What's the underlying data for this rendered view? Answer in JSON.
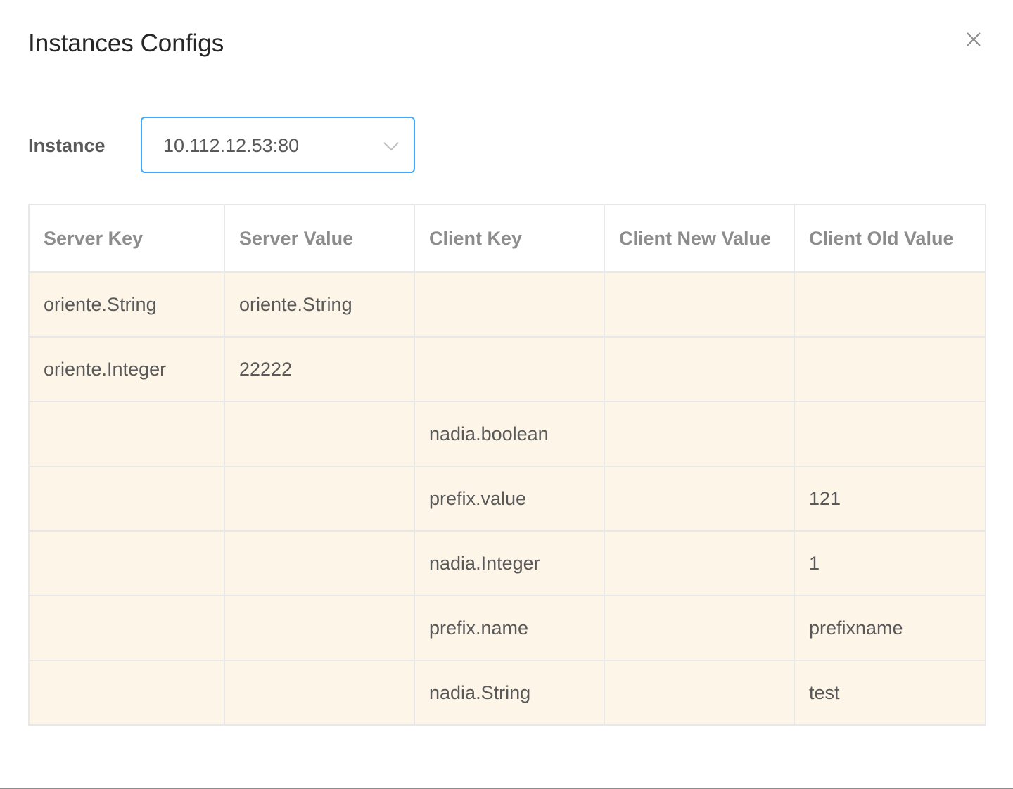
{
  "dialog": {
    "title": "Instances Configs",
    "close_icon": "close-icon"
  },
  "instance_field": {
    "label": "Instance",
    "selected_value": "10.112.12.53:80",
    "arrow_icon": "chevron-down-icon"
  },
  "table": {
    "columns": [
      "Server Key",
      "Server Value",
      "Client Key",
      "Client New Value",
      "Client Old Value"
    ],
    "rows": [
      [
        "oriente.String",
        "oriente.String",
        "",
        "",
        ""
      ],
      [
        "oriente.Integer",
        "22222",
        "",
        "",
        ""
      ],
      [
        "",
        "",
        "nadia.boolean",
        "",
        ""
      ],
      [
        "",
        "",
        "prefix.value",
        "",
        "121"
      ],
      [
        "",
        "",
        "nadia.Integer",
        "",
        "1"
      ],
      [
        "",
        "",
        "prefix.name",
        "",
        "prefixname"
      ],
      [
        "",
        "",
        "nadia.String",
        "",
        "test"
      ]
    ]
  },
  "colors": {
    "select_border": "#40a9ff",
    "row_background": "#fdf5e8",
    "header_text": "#8c8c8c",
    "cell_text": "#595959"
  }
}
